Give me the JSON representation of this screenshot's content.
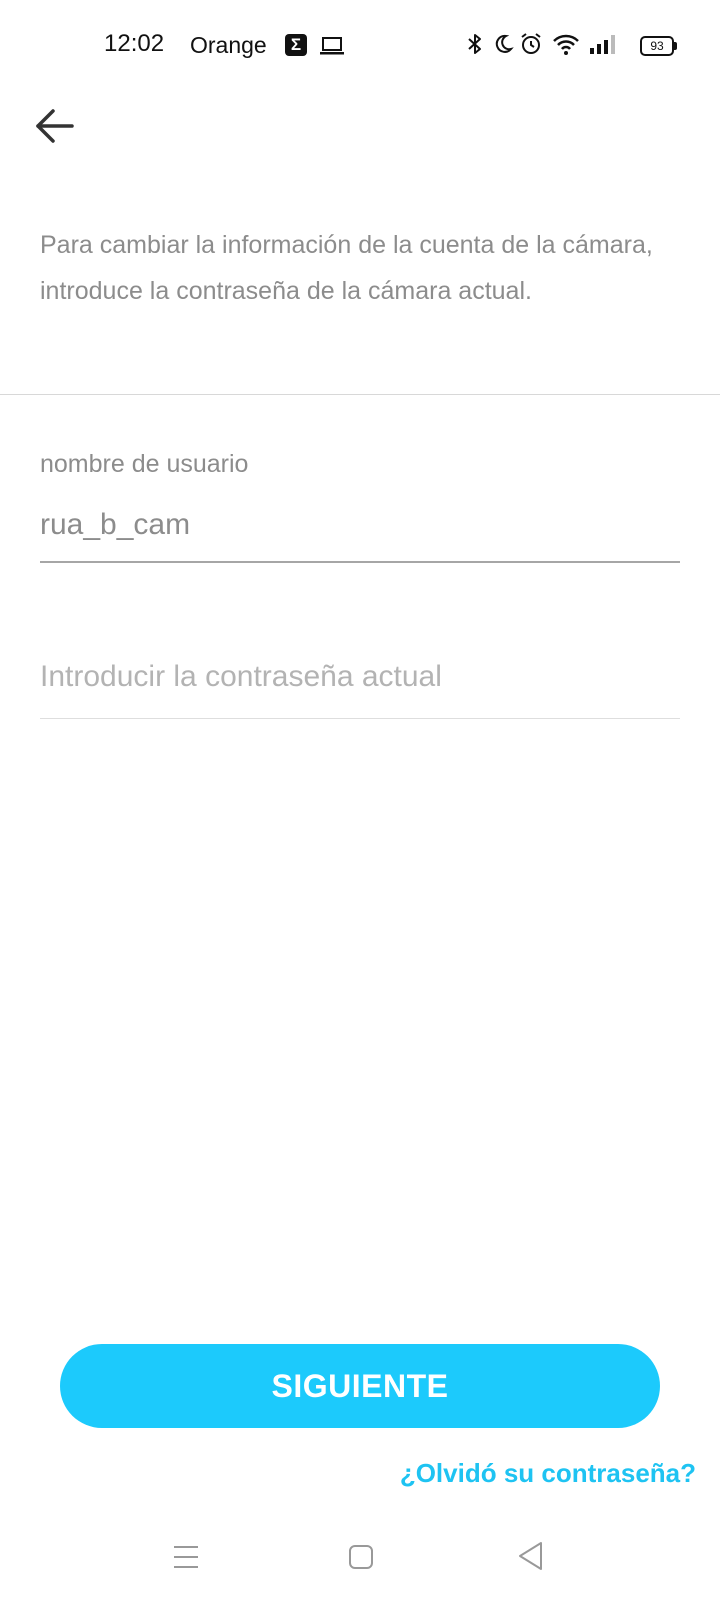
{
  "status_bar": {
    "time": "12:02",
    "carrier": "Orange",
    "sigma_glyph": "Σ",
    "battery": "93",
    "icons": [
      "sigma-app-icon",
      "laptop-icon",
      "bluetooth-icon",
      "moon-icon",
      "alarm-icon",
      "wifi-icon",
      "signal-icon",
      "battery-icon"
    ]
  },
  "header": {
    "back_icon": "arrow-left-icon"
  },
  "description": "Para cambiar la información de la cuenta de la cámara, introduce la contraseña de la cámara actual.",
  "username": {
    "label": "nombre de usuario",
    "value": "rua_b_cam"
  },
  "password": {
    "placeholder": "Introducir la contraseña actual",
    "value": ""
  },
  "next_button": {
    "label": "SIGUIENTE",
    "color": "#1ccafc"
  },
  "forgot_link": {
    "label": "¿Olvidó su contraseña?",
    "color": "#1ec3f2"
  },
  "nav_bar": {
    "icons": [
      "menu-icon",
      "home-square-icon",
      "back-triangle-icon"
    ]
  }
}
